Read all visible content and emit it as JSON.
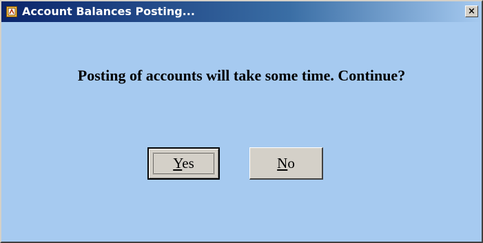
{
  "window": {
    "title": "Account Balances Posting...",
    "close_glyph": "×",
    "icon": "app-icon"
  },
  "dialog": {
    "message": "Posting of accounts will take some time. Continue?"
  },
  "buttons": {
    "yes": {
      "mnemonic": "Y",
      "rest": "es"
    },
    "no": {
      "mnemonic": "N",
      "rest": "o"
    }
  },
  "colors": {
    "title_start": "#0a246a",
    "title_end": "#a6caf0",
    "dialog_bg": "#a6caf0",
    "button_bg": "#d4d0c8"
  }
}
